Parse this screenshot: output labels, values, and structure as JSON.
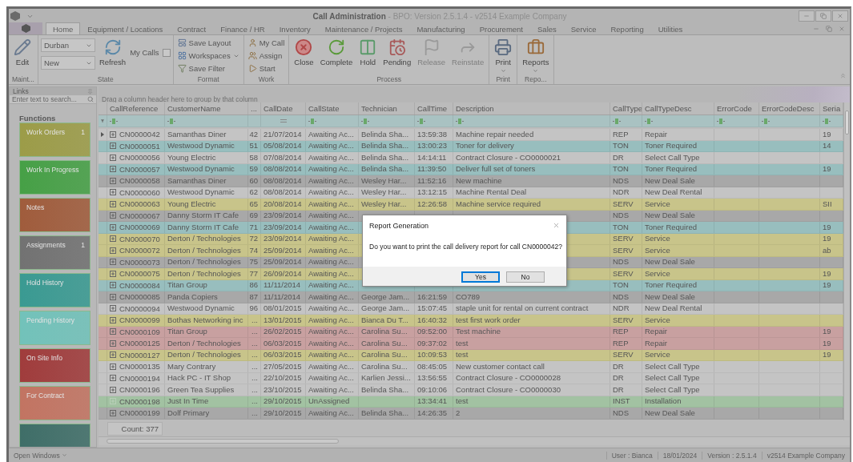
{
  "window": {
    "title": "Call Administration",
    "subtitle": " - BPO: Version 2.5.1.4 - v2514 Example Company"
  },
  "tabs": [
    {
      "label": "Home",
      "selected": true
    },
    {
      "label": "Equipment / Locations",
      "selected": false
    },
    {
      "label": "Contract",
      "selected": false
    },
    {
      "label": "Finance / HR",
      "selected": false
    },
    {
      "label": "Inventory",
      "selected": false
    },
    {
      "label": "Maintenance / Projects",
      "selected": false
    },
    {
      "label": "Manufacturing",
      "selected": false
    },
    {
      "label": "Procurement",
      "selected": false
    },
    {
      "label": "Sales",
      "selected": false
    },
    {
      "label": "Service",
      "selected": false
    },
    {
      "label": "Reporting",
      "selected": false
    },
    {
      "label": "Utilities",
      "selected": false
    }
  ],
  "ribbon": [
    {
      "label": "Maint...",
      "items": [
        {
          "kind": "large",
          "label": "Edit",
          "disabled": false
        }
      ]
    },
    {
      "label": "State",
      "items": [
        {
          "kind": "dropdown",
          "value": "Durban"
        },
        {
          "kind": "dropdown",
          "value": "New"
        },
        {
          "kind": "large",
          "label": "Refresh",
          "disabled": false
        },
        {
          "kind": "checkbox",
          "label": "My Calls",
          "checked": false
        }
      ]
    },
    {
      "label": "Format",
      "items": [
        {
          "kind": "small",
          "label": "Save Layout",
          "menu": false
        },
        {
          "kind": "small",
          "label": "Workspaces",
          "menu": true
        },
        {
          "kind": "small",
          "label": "Save Filter",
          "menu": false
        }
      ]
    },
    {
      "label": "Work",
      "items": [
        {
          "kind": "small",
          "label": "My Call",
          "menu": false
        },
        {
          "kind": "small",
          "label": "Assign",
          "menu": false
        },
        {
          "kind": "small",
          "label": "Start",
          "menu": false
        }
      ]
    },
    {
      "label": "Process",
      "items": [
        {
          "kind": "large",
          "label": "Close",
          "disabled": false
        },
        {
          "kind": "large",
          "label": "Complete",
          "disabled": false
        },
        {
          "kind": "large",
          "label": "Hold",
          "disabled": false
        },
        {
          "kind": "large",
          "label": "Pending",
          "disabled": false
        },
        {
          "kind": "large",
          "label": "Release",
          "disabled": true
        },
        {
          "kind": "large",
          "label": "Reinstate",
          "disabled": true
        }
      ]
    },
    {
      "label": "Print",
      "items": [
        {
          "kind": "large",
          "label": "Print",
          "disabled": false,
          "menu": true
        }
      ]
    },
    {
      "label": "Repo...",
      "items": [
        {
          "kind": "large",
          "label": "Reports",
          "disabled": false,
          "menu": true
        }
      ]
    }
  ],
  "links": {
    "title": "Links",
    "search": {
      "placeholder": "Enter text to search..."
    },
    "heading": "Functions",
    "tiles": [
      {
        "label": "Work Orders",
        "count": "1",
        "color": "#9c9c48"
      },
      {
        "label": "Work In Progress",
        "color": "#46a046"
      },
      {
        "label": "Notes",
        "color": "#a05c3c"
      },
      {
        "label": "Assignments",
        "count": "1",
        "color": "#727272"
      },
      {
        "label": "Hold History",
        "color": "#3a9a92"
      },
      {
        "label": "Pending History",
        "color": "#72c2ba"
      },
      {
        "label": "On Site Info",
        "color": "#a03c3c"
      },
      {
        "label": "For Contract",
        "color": "#c27462"
      },
      {
        "color": "#3f6e68"
      }
    ]
  },
  "grid": {
    "group_hint": "Drag a column header here to group by that column",
    "columns": [
      {
        "label": "CallReference",
        "kind": "text"
      },
      {
        "label": "CustomerName",
        "kind": "text"
      },
      {
        "label": "..."
      },
      {
        "label": "CallDate",
        "kind": "date"
      },
      {
        "label": "CallState",
        "kind": "text"
      },
      {
        "label": "Technician",
        "kind": "text"
      },
      {
        "label": "CallTime",
        "kind": "text"
      },
      {
        "label": "Description",
        "kind": "text"
      },
      {
        "label": "CallType",
        "kind": "text"
      },
      {
        "label": "CallTypeDesc",
        "kind": "text"
      },
      {
        "label": "ErrorCode",
        "kind": "text"
      },
      {
        "label": "ErrorCodeDesc",
        "kind": "text"
      },
      {
        "label": "Seria",
        "kind": "text"
      }
    ],
    "rows": [
      {
        "current": true,
        "expandable": true,
        "color": "#c4c4c4",
        "cells": [
          "CN0000042",
          "Samanthas Diner",
          "42",
          "21/07/2014",
          "Awaiting Ac...",
          "Belinda Sha...",
          "13:59:38",
          "Machine repair needed",
          "REP",
          "Repair",
          null,
          null,
          "19"
        ]
      },
      {
        "current": false,
        "expandable": true,
        "color": "#98bebe",
        "cells": [
          "CN0000051",
          "Westwood Dynamic",
          "51",
          "05/08/2014",
          "Awaiting Ac...",
          "Belinda Sha...",
          "13:00:23",
          "Toner for delivery",
          "TON",
          "Toner Required",
          null,
          null,
          "14"
        ]
      },
      {
        "current": false,
        "expandable": true,
        "color": "#c4c4c4",
        "cells": [
          "CN0000056",
          "Young Electric",
          "58",
          "07/08/2014",
          "Awaiting Ac...",
          "Belinda Sha...",
          "14:14:11",
          "Contract Closure - CO0000021",
          "DR",
          "Select Call Type",
          null,
          null,
          null
        ]
      },
      {
        "current": false,
        "expandable": true,
        "color": "#98bebe",
        "cells": [
          "CN0000057",
          "Westwood Dynamic",
          "59",
          "08/08/2014",
          "Awaiting Ac...",
          "Belinda Sha...",
          "11:39:50",
          "Deliver full set of toners",
          "TON",
          "Toner Required",
          null,
          null,
          "19"
        ]
      },
      {
        "current": false,
        "expandable": true,
        "color": "#a8a8a8",
        "cells": [
          "CN0000058",
          "Samanthas Diner",
          "60",
          "08/08/2014",
          "Awaiting Ac...",
          "Wesley Har...",
          "11:52:16",
          "New machine",
          "NDS",
          "New Deal Sale",
          null,
          null,
          null
        ]
      },
      {
        "current": false,
        "expandable": true,
        "color": "#c4c4c4",
        "cells": [
          "CN0000060",
          "Westwood Dynamic",
          "62",
          "08/08/2014",
          "Awaiting Ac...",
          "Wesley Har...",
          "13:12:15",
          "Machine Rental Deal",
          "NDR",
          "New Deal Rental",
          null,
          null,
          null
        ]
      },
      {
        "current": false,
        "expandable": true,
        "color": "#c8c48a",
        "cells": [
          "CN0000063",
          "Young Electric",
          "65",
          "20/08/2014",
          "Awaiting Ac...",
          "Wesley Har...",
          "12:26:58",
          "Machine service required",
          "SERV",
          "Service",
          null,
          null,
          "SII"
        ]
      },
      {
        "current": false,
        "expandable": true,
        "color": "#a8a8a8",
        "cells": [
          "CN0000067",
          "Danny Storm IT Cafe",
          "69",
          "23/09/2014",
          "Awaiting Ac...",
          null,
          null,
          null,
          "NDS",
          "New Deal Sale",
          null,
          null,
          null
        ]
      },
      {
        "current": false,
        "expandable": true,
        "color": "#98bebe",
        "cells": [
          "CN0000069",
          "Danny Storm IT Cafe",
          "71",
          "23/09/2014",
          "Awaiting Ac...",
          null,
          null,
          null,
          "TON",
          "Toner Required",
          null,
          null,
          "19"
        ]
      },
      {
        "current": false,
        "expandable": true,
        "color": "#c8c48a",
        "cells": [
          "CN0000070",
          "Derton / Technologies",
          "72",
          "23/09/2014",
          "Awaiting Ac...",
          null,
          null,
          null,
          "SERV",
          "Service",
          null,
          null,
          "19"
        ]
      },
      {
        "current": false,
        "expandable": true,
        "color": "#c8c48a",
        "cells": [
          "CN0000072",
          "Derton / Technologies",
          "74",
          "25/09/2014",
          "Awaiting Ac...",
          null,
          null,
          null,
          "SERV",
          "Service",
          null,
          null,
          "ab"
        ]
      },
      {
        "current": false,
        "expandable": true,
        "color": "#a8a8a8",
        "cells": [
          "CN0000073",
          "Derton / Technologies",
          "75",
          "25/09/2014",
          "Awaiting Ac...",
          null,
          null,
          null,
          "NDS",
          "New Deal Sale",
          null,
          null,
          null
        ]
      },
      {
        "current": false,
        "expandable": true,
        "color": "#c8c48a",
        "cells": [
          "CN0000075",
          "Derton / Technologies",
          "77",
          "26/09/2014",
          "Awaiting Ac...",
          null,
          null,
          null,
          "SERV",
          "Service",
          null,
          null,
          "19"
        ]
      },
      {
        "current": false,
        "expandable": true,
        "color": "#98bebe",
        "cells": [
          "CN0000084",
          "Titan Group",
          "86",
          "11/11/2014",
          "Awaiting Ac...",
          null,
          null,
          null,
          "TON",
          "Toner Required",
          null,
          null,
          "19"
        ]
      },
      {
        "current": false,
        "expandable": true,
        "color": "#a8a8a8",
        "cells": [
          "CN0000085",
          "Panda Copiers",
          "87",
          "11/11/2014",
          "Awaiting Ac...",
          "George Jam...",
          "16:21:59",
          "CO789",
          "NDS",
          "New Deal Sale",
          null,
          null,
          null
        ]
      },
      {
        "current": false,
        "expandable": true,
        "color": "#c4c4c4",
        "cells": [
          "CN0000094",
          "Westwood Dynamic",
          "96",
          "08/01/2015",
          "Awaiting Ac...",
          "George Jam...",
          "15:07:45",
          "staple unit for rental on current contract",
          "NDR",
          "New Deal Rental",
          null,
          null,
          null
        ]
      },
      {
        "current": false,
        "expandable": true,
        "color": "#c8c48a",
        "cells": [
          "CN0000099",
          "Bothas Networking inc",
          "...",
          "13/01/2015",
          "Awaiting Ac...",
          "Bianca Du T...",
          "16:40:32",
          "test first work order",
          "SERV",
          "Service",
          null,
          null,
          null
        ]
      },
      {
        "current": false,
        "expandable": true,
        "color": "#c8a0a0",
        "cells": [
          "CN0000109",
          "Titan Group",
          "...",
          "26/02/2015",
          "Awaiting Ac...",
          "Carolina Su...",
          "09:52:00",
          "Test machine",
          "REP",
          "Repair",
          null,
          null,
          "19"
        ]
      },
      {
        "current": false,
        "expandable": true,
        "color": "#c8a0a0",
        "cells": [
          "CN0000125",
          "Derton / Technologies",
          "...",
          "06/03/2015",
          "Awaiting Ac...",
          "Carolina Su...",
          "09:37:02",
          "test",
          "REP",
          "Repair",
          null,
          null,
          "19"
        ]
      },
      {
        "current": false,
        "expandable": true,
        "color": "#c8c48a",
        "cells": [
          "CN0000127",
          "Derton / Technologies",
          "...",
          "06/03/2015",
          "Awaiting Ac...",
          "Carolina Su...",
          "10:09:53",
          "test",
          "SERV",
          "Service",
          null,
          null,
          "19"
        ]
      },
      {
        "current": false,
        "expandable": true,
        "color": "#c4c4c4",
        "cells": [
          "CN0000135",
          "Mary Contrary",
          "...",
          "27/05/2015",
          "Awaiting Ac...",
          "Carolina Su...",
          "08:45:05",
          "New customer contact call",
          "DR",
          "Select Call Type",
          null,
          null,
          null
        ]
      },
      {
        "current": false,
        "expandable": true,
        "color": "#c4c4c4",
        "cells": [
          "CN0000194",
          "Hack PC - IT Shop",
          "...",
          "22/10/2015",
          "Awaiting Ac...",
          "Karlien Jessi...",
          "13:56:55",
          "Contract Closure - CO0000028",
          "DR",
          "Select Call Type",
          null,
          null,
          null
        ]
      },
      {
        "current": false,
        "expandable": true,
        "color": "#c4c4c4",
        "cells": [
          "CN0000196",
          "Green Tea Supplies",
          "...",
          "23/10/2015",
          "Awaiting Ac...",
          "Belinda Sha...",
          "09:10:06",
          "Contract Closure - CO0000030",
          "DR",
          "Select Call Type",
          null,
          null,
          null
        ]
      },
      {
        "current": false,
        "expandable": false,
        "color": "#a2c2a2",
        "cells": [
          "CN0000198",
          "Just In Time",
          "...",
          "29/10/2015",
          "UnAssigned",
          null,
          "13:34:41",
          "test",
          "INST",
          "Installation",
          null,
          null,
          null
        ]
      },
      {
        "current": false,
        "expandable": true,
        "color": "#a8a8a8",
        "cells": [
          "CN0000199",
          "Dolf Primary",
          "...",
          "29/10/2015",
          "Awaiting Ac...",
          "Belinda Sha...",
          "14:26:35",
          "2",
          "NDS",
          "New Deal Sale",
          null,
          null,
          null
        ]
      }
    ],
    "count": "Count: 377"
  },
  "dialog": {
    "title": "Report Generation",
    "message": "Do you want to print the call delivery report for call CN0000042?",
    "buttons": [
      {
        "label": "Yes",
        "selected": true
      },
      {
        "label": "No",
        "selected": false
      }
    ]
  },
  "status_bar": {
    "open_windows": "Open Windows",
    "items": [
      "User : Bianca",
      "18/01/2024",
      "Version : 2.5.1.4",
      "v2514 Example Company"
    ]
  }
}
